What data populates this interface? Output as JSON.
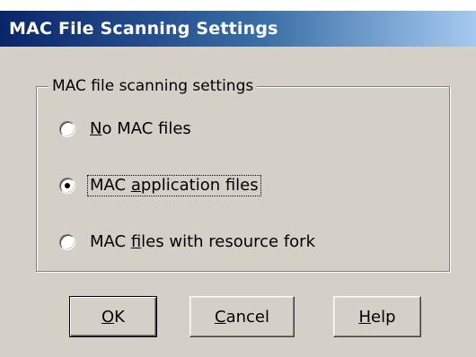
{
  "window": {
    "title": "MAC File Scanning Settings"
  },
  "group": {
    "legend": "MAC file scanning settings",
    "options": [
      {
        "pre": "",
        "ul": "N",
        "post": "o MAC files",
        "checked": false,
        "focused": false
      },
      {
        "pre": "MAC ",
        "ul": "a",
        "post": "pplication files",
        "checked": true,
        "focused": true
      },
      {
        "pre": "MAC ",
        "ul": "f",
        "post": "iles with resource fork",
        "checked": false,
        "focused": false
      }
    ]
  },
  "buttons": {
    "ok": {
      "ul": "O",
      "post": "K"
    },
    "cancel": {
      "ul": "C",
      "post": "ancel"
    },
    "help": {
      "ul": "H",
      "post": "elp"
    }
  },
  "colors": {
    "face": "#d4d0c8",
    "title_start": "#0a246a",
    "title_end": "#a6caf0"
  }
}
